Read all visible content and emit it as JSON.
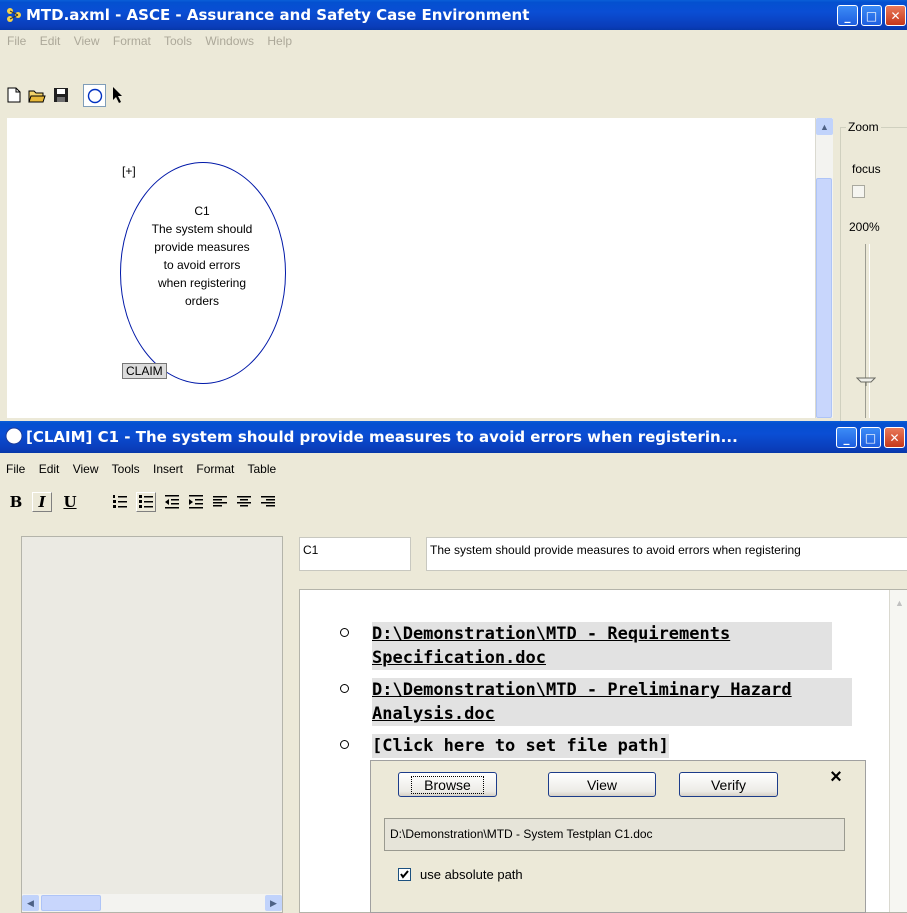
{
  "main_window": {
    "title": "MTD.axml - ASCE - Assurance and Safety Case Environment",
    "menu": [
      "File",
      "Edit",
      "View",
      "Format",
      "Tools",
      "Windows",
      "Help"
    ],
    "zoom": {
      "label": "Zoom",
      "focus_label": "focus",
      "level": "200%"
    },
    "node": {
      "expand": "[+]",
      "id": "C1",
      "text": "The system should provide measures to avoid errors when registering orders",
      "type_label": "CLAIM"
    }
  },
  "claim_window": {
    "title": "[CLAIM] C1 - The system should provide measures to avoid errors when registerin...",
    "menu": [
      "File",
      "Edit",
      "View",
      "Tools",
      "Insert",
      "Format",
      "Table"
    ],
    "format_buttons": {
      "bold": "B",
      "italic": "I",
      "underline": "U"
    },
    "id_value": "C1",
    "title_value": "The system should provide measures to avoid errors when registering",
    "links": [
      "D:\\Demonstration\\MTD - Requirements Specification.doc",
      "D:\\Demonstration\\MTD - Preliminary Hazard Analysis.doc",
      "[Click here to set file path]"
    ],
    "popup": {
      "browse": "Browse",
      "view": "View",
      "verify": "Verify",
      "close": "×",
      "path_value": "D:\\Demonstration\\MTD - System Testplan C1.doc",
      "checkbox_label": "use absolute path",
      "checkbox_checked": true
    }
  }
}
